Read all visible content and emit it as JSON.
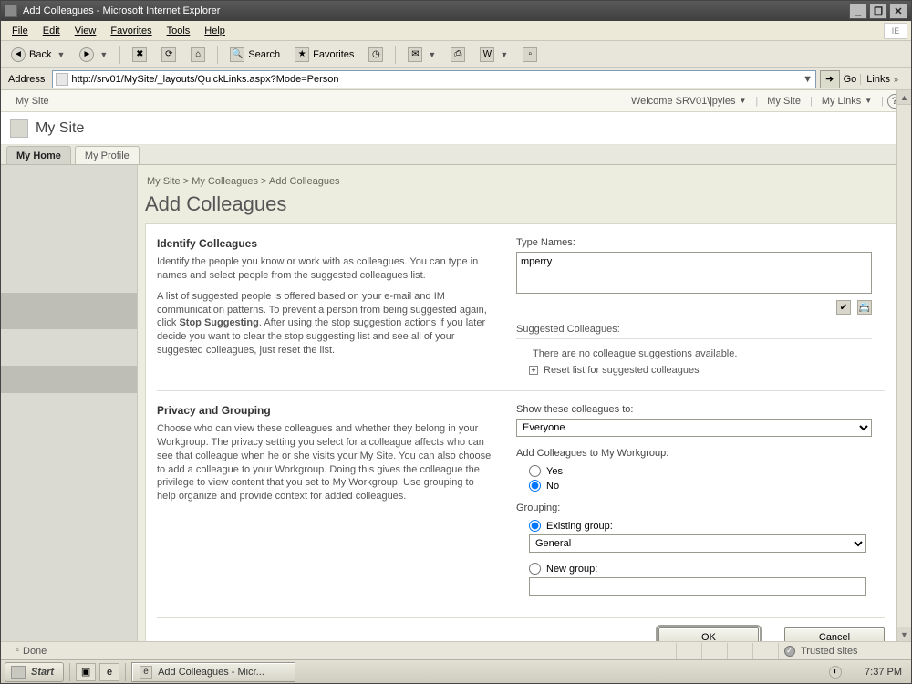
{
  "window": {
    "title": "Add Colleagues - Microsoft Internet Explorer",
    "min_label": "_",
    "max_label": "❐",
    "close_label": "✕"
  },
  "menubar": [
    "File",
    "Edit",
    "View",
    "Favorites",
    "Tools",
    "Help"
  ],
  "toolbar": {
    "back": "Back",
    "search": "Search",
    "favorites": "Favorites"
  },
  "addressbar": {
    "label": "Address",
    "url": "http://srv01/MySite/_layouts/QuickLinks.aspx?Mode=Person",
    "go": "Go",
    "links_label": "Links"
  },
  "topstrip": {
    "site_link": "My Site",
    "welcome": "Welcome SRV01\\jpyles",
    "mysite": "My Site",
    "mylinks": "My Links"
  },
  "site": {
    "title": "My Site",
    "tabs": [
      "My Home",
      "My Profile"
    ],
    "active_tab": 0
  },
  "breadcrumb": "My Site > My Colleagues > Add Colleagues",
  "page": {
    "title": "Add Colleagues",
    "section1": {
      "heading": "Identify Colleagues",
      "p1": "Identify the people you know or work with as colleagues. You can type in names and select people from the suggested colleagues list.",
      "p2a": "A list of suggested people is offered based on your e-mail and IM communication patterns. To prevent a person from being suggested again, click ",
      "p2b": "Stop Suggesting",
      "p2c": ". After using the stop suggestion actions if you later decide you want to clear the stop suggesting list and see all of your suggested colleagues, just reset the list.",
      "right": {
        "type_names_label": "Type Names:",
        "type_names_value": "mperry",
        "suggested_label": "Suggested Colleagues:",
        "no_suggestions": "There are no colleague suggestions available.",
        "reset_label": "Reset list for suggested colleagues"
      }
    },
    "section2": {
      "heading": "Privacy and Grouping",
      "p1": "Choose who can view these colleagues and whether they belong in your Workgroup. The privacy setting you select for a colleague affects who can see that colleague when he or she visits your My Site. You can also choose to add a colleague to your Workgroup. Doing this gives the colleague the privilege to view content that you set to My Workgroup. Use grouping to help organize and provide context for added colleagues.",
      "right": {
        "show_to_label": "Show these colleagues to:",
        "show_to_value": "Everyone",
        "workgroup_label": "Add Colleagues to My Workgroup:",
        "yes": "Yes",
        "no": "No",
        "grouping_label": "Grouping:",
        "existing_group": "Existing group:",
        "existing_group_value": "General",
        "new_group": "New group:",
        "new_group_value": ""
      }
    },
    "buttons": {
      "ok": "OK",
      "cancel": "Cancel"
    }
  },
  "statusbar": {
    "status": "Done",
    "zone": "Trusted sites"
  },
  "taskbar": {
    "start": "Start",
    "task": "Add Colleagues - Micr...",
    "time": "7:37 PM"
  }
}
